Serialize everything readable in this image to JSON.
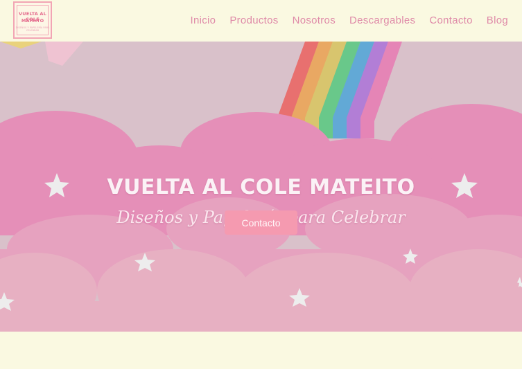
{
  "logo": {
    "line1": "VUELTA AL COLE",
    "line2": "MATEITO",
    "line3": "DISEÑOS Y PAPELERÍA PARA CELEBRAR"
  },
  "nav": [
    {
      "label": "Inicio"
    },
    {
      "label": "Productos"
    },
    {
      "label": "Nosotros"
    },
    {
      "label": "Descargables"
    },
    {
      "label": "Contacto"
    },
    {
      "label": "Blog"
    }
  ],
  "hero": {
    "title": "VUELTA AL COLE MATEITO",
    "subtitle": "Diseños y Papelería para Celebrar",
    "cta_label": "Contacto",
    "rainbow_colors": [
      "#e8706f",
      "#e9a863",
      "#d8c56e",
      "#69c88a",
      "#62a9d6",
      "#b27ed6",
      "#e585b6"
    ]
  },
  "colors": {
    "background": "#faf9e1",
    "nav_text": "#df8aa8",
    "button": "#f59ab0",
    "cloud": "#e89bbf"
  }
}
